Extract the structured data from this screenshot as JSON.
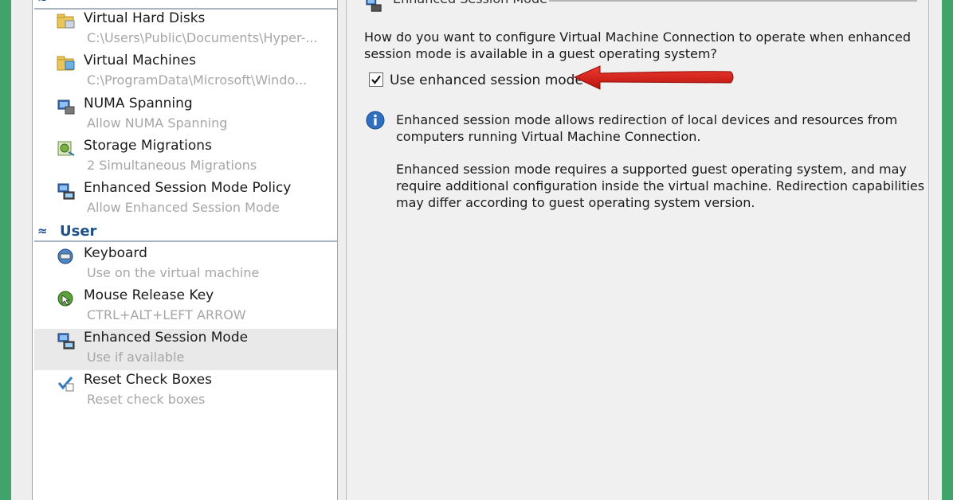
{
  "left": {
    "server_items": [
      {
        "label": "Virtual Hard Disks",
        "sub": "C:\\Users\\Public\\Documents\\Hyper-...",
        "icon": "folder-disk-icon"
      },
      {
        "label": "Virtual Machines",
        "sub": "C:\\ProgramData\\Microsoft\\Windo...",
        "icon": "folder-vm-icon"
      },
      {
        "label": "NUMA Spanning",
        "sub": "Allow NUMA Spanning",
        "icon": "numa-icon"
      },
      {
        "label": "Storage Migrations",
        "sub": "2 Simultaneous Migrations",
        "icon": "storage-migration-icon"
      },
      {
        "label": "Enhanced Session Mode Policy",
        "sub": "Allow Enhanced Session Mode",
        "icon": "session-policy-icon"
      }
    ],
    "user_section": {
      "title": "User",
      "icon": "collapse-chevron-icon"
    },
    "user_items": [
      {
        "label": "Keyboard",
        "sub": "Use on the virtual machine",
        "icon": "keyboard-icon"
      },
      {
        "label": "Mouse Release Key",
        "sub": "CTRL+ALT+LEFT ARROW",
        "icon": "mouse-release-icon"
      },
      {
        "label": "Enhanced Session Mode",
        "sub": "Use if available",
        "icon": "enhanced-session-icon"
      },
      {
        "label": "Reset Check Boxes",
        "sub": "Reset check boxes",
        "icon": "reset-checkbox-icon"
      }
    ]
  },
  "right": {
    "group_title": "Enhanced Session Mode",
    "question_line1": "How do you want to configure Virtual Machine Connection to operate when enhanced",
    "question_line2": "session mode is available in a guest operating system?",
    "checkbox_label": "Use enhanced session mode",
    "checkbox_checked": true,
    "info_p1_line1": "Enhanced session mode allows redirection of local devices and resources from",
    "info_p1_line2": "computers running Virtual Machine Connection.",
    "info_p2_line1": "Enhanced session mode requires a supported guest operating system, and may",
    "info_p2_line2": "require additional configuration inside the virtual machine. Redirection capabilities",
    "info_p2_line3": "may differ according to guest operating system version."
  },
  "colors": {
    "accent": "#1e4f8c",
    "arrow": "#d41c1c",
    "window_border": "#3fa36a"
  }
}
